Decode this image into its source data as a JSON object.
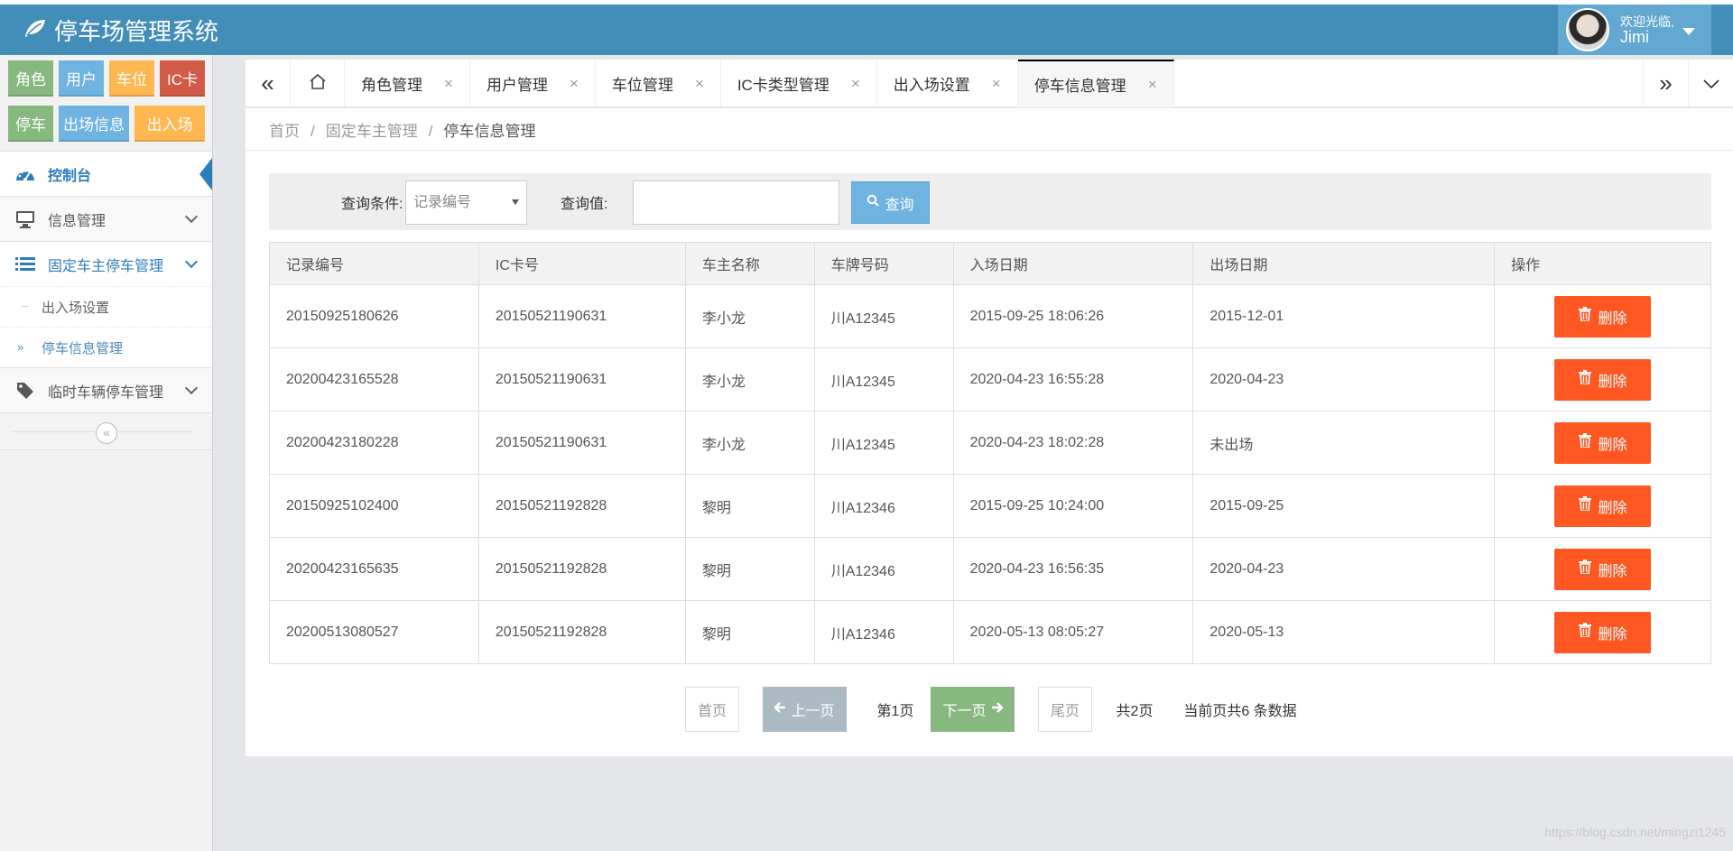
{
  "app": {
    "title": "停车场管理系统"
  },
  "user": {
    "welcome": "欢迎光临,",
    "name": "Jimi"
  },
  "shortcuts": [
    [
      {
        "label": "角色",
        "color": "#87b87f",
        "w": 50
      },
      {
        "label": "用户",
        "color": "#6fb3e0",
        "w": 50
      },
      {
        "label": "车位",
        "color": "#ffb752",
        "w": 50
      },
      {
        "label": "IC卡",
        "color": "#d15b47",
        "w": 50
      }
    ],
    [
      {
        "label": "停车",
        "color": "#87b87f",
        "w": 50
      },
      {
        "label": "出场信息",
        "color": "#6fb3e0",
        "w": 78
      },
      {
        "label": "出入场",
        "color": "#ffb752",
        "w": 78
      }
    ]
  ],
  "sidebar": {
    "dashboard": "控制台",
    "info": "信息管理",
    "fixed": "固定车主停车管理",
    "fixed_sub": [
      "出入场设置",
      "停车信息管理"
    ],
    "temp": "临时车辆停车管理"
  },
  "tabs": [
    "角色管理",
    "用户管理",
    "车位管理",
    "IC卡类型管理",
    "出入场设置",
    "停车信息管理"
  ],
  "tab_close": "×",
  "breadcrumb": [
    "首页",
    "固定车主管理",
    "停车信息管理"
  ],
  "breadcrumb_sep": "/",
  "query": {
    "condition_label": "查询条件:",
    "condition_value": "记录编号",
    "value_label": "查询值:",
    "value": "",
    "button": "查询"
  },
  "table": {
    "columns": [
      "记录编号",
      "IC卡号",
      "车主名称",
      "车牌号码",
      "入场日期",
      "出场日期",
      "操作"
    ],
    "delete_label": "删除",
    "rows": [
      [
        "20150925180626",
        "20150521190631",
        "李小龙",
        "川A12345",
        "2015-09-25 18:06:26",
        "2015-12-01"
      ],
      [
        "20200423165528",
        "20150521190631",
        "李小龙",
        "川A12345",
        "2020-04-23 16:55:28",
        "2020-04-23"
      ],
      [
        "20200423180228",
        "20150521190631",
        "李小龙",
        "川A12345",
        "2020-04-23 18:02:28",
        "未出场"
      ],
      [
        "20150925102400",
        "20150521192828",
        "黎明",
        "川A12346",
        "2015-09-25 10:24:00",
        "2015-09-25"
      ],
      [
        "20200423165635",
        "20150521192828",
        "黎明",
        "川A12346",
        "2020-04-23 16:56:35",
        "2020-04-23"
      ],
      [
        "20200513080527",
        "20150521192828",
        "黎明",
        "川A12346",
        "2020-05-13 08:05:27",
        "2020-05-13"
      ]
    ]
  },
  "pager": {
    "first": "首页",
    "prev": "上一页",
    "current": "第1页",
    "next": "下一页",
    "last": "尾页",
    "total": "共2页",
    "count": "当前页共6 条数据"
  },
  "watermark": "https://blog.csdn.net/mingzi1245",
  "colors": {
    "header": "#438eb9",
    "accent": "#2b7dbc",
    "delete": "#ff5722",
    "query_btn": "#6fb3e0"
  }
}
